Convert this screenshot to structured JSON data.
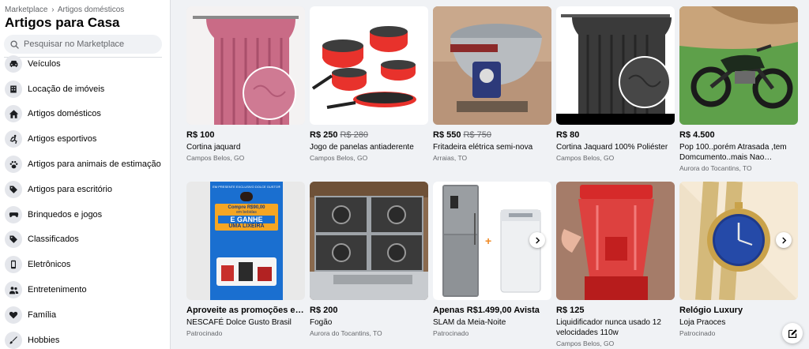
{
  "sidebar": {
    "breadcrumb": [
      "Marketplace",
      "Artigos domésticos"
    ],
    "breadcrumb_sep": "›",
    "title": "Artigos para Casa",
    "search_placeholder": "Pesquisar no Marketplace",
    "categories": [
      {
        "label": "Veículos",
        "icon": "car-icon"
      },
      {
        "label": "Locação de imóveis",
        "icon": "building-icon"
      },
      {
        "label": "Artigos domésticos",
        "icon": "home-icon"
      },
      {
        "label": "Artigos esportivos",
        "icon": "running-icon"
      },
      {
        "label": "Artigos para animais de estimação",
        "icon": "paw-icon"
      },
      {
        "label": "Artigos para escritório",
        "icon": "tag-icon"
      },
      {
        "label": "Brinquedos e jogos",
        "icon": "controller-icon"
      },
      {
        "label": "Classificados",
        "icon": "tag-icon"
      },
      {
        "label": "Eletrônicos",
        "icon": "phone-icon"
      },
      {
        "label": "Entretenimento",
        "icon": "people-icon"
      },
      {
        "label": "Família",
        "icon": "heart-icon"
      },
      {
        "label": "Hobbies",
        "icon": "brush-icon"
      }
    ]
  },
  "listings": [
    {
      "price": "R$ 100",
      "old_price": "",
      "title": "Cortina jaquard",
      "location": "Campos Belos, GO",
      "image": "pink-curtain"
    },
    {
      "price": "R$ 250",
      "old_price": "R$ 280",
      "title": "Jogo de panelas antiaderente",
      "location": "Campos Belos, GO",
      "image": "red-cookware-set"
    },
    {
      "price": "R$ 550",
      "old_price": "R$ 750",
      "title": "Fritadeira elétrica semi-nova",
      "location": "Arraias, TO",
      "image": "electric-fryer"
    },
    {
      "price": "R$ 80",
      "old_price": "",
      "title": "Cortina Jaquard 100% Poliéster",
      "location": "Campos Belos, GO",
      "image": "black-curtain"
    },
    {
      "price": "R$ 4.500",
      "old_price": "",
      "title": "Pop 100..porém Atrasada ,tem Domcumento..mais Nao Compensa...",
      "location": "Aurora do Tocantins, TO",
      "image": "motorcycle"
    },
    {
      "price": "Aproveite as promoções exclu...",
      "old_price": "",
      "title": "NESCAFÉ Dolce Gusto Brasil",
      "location": "Patrocinado",
      "image": "nescafe-ad",
      "ad": {
        "top": "EM PRESENTE EXCLUSIVO DOLCE GUSTO®",
        "line1": "Compre R$90,00",
        "line2": "em bebidas",
        "line3": "E GANHE",
        "line4": "UMA LIXEIRA"
      }
    },
    {
      "price": "R$ 200",
      "old_price": "",
      "title": "Fogão",
      "location": "Aurora do Tocantins, TO",
      "image": "gas-stove"
    },
    {
      "price": "Apenas R$1.499,00 Avista",
      "old_price": "",
      "title": "SLAM da Meia-Noite",
      "location": "Patrocinado",
      "image": "fridge-and-washer"
    },
    {
      "price": "R$ 125",
      "old_price": "",
      "title": "Liquidificador nunca usado 12 velocidades 110w",
      "location": "Campos Belos, GO",
      "image": "red-blender"
    },
    {
      "price": "Relógio Luxury",
      "old_price": "",
      "title": "Loja Praoces",
      "location": "Patrocinado",
      "image": "gold-watch"
    }
  ],
  "colors": {
    "accent": "#1877f2",
    "secondary_text": "#65676b",
    "background": "#f0f2f5",
    "ad_blue": "#1a6fd0",
    "ad_orange": "#f5a623"
  }
}
